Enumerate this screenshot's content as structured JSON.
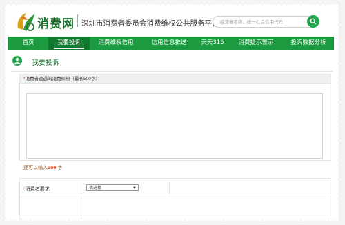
{
  "header": {
    "logo_text": "消费网",
    "tagline": "深圳市消费者委员会消费维权公共服务平台",
    "search_placeholder": "经营者名称、统一社会信用代码"
  },
  "nav": {
    "items": [
      {
        "label": "首页"
      },
      {
        "label": "我要投诉"
      },
      {
        "label": "消费维权信用"
      },
      {
        "label": "信用信息推送"
      },
      {
        "label": "天天315"
      },
      {
        "label": "消费提示警示"
      },
      {
        "label": "投诉数据分析"
      }
    ],
    "active_index": 1
  },
  "section": {
    "title": "我要投诉"
  },
  "form": {
    "desc_required_mark": "*",
    "desc_label": "消费者遭遇的消费纠纷（最长500字）：",
    "counter_prefix": "还可以输入",
    "counter_value": "500",
    "counter_suffix": "字",
    "request_required_mark": "*",
    "request_label": "消费者要求:",
    "request_select_value": "请选择"
  },
  "colors": {
    "brand_green": "#1c9a3f",
    "active_green": "#127a2e",
    "required_red": "#e23a3a"
  }
}
